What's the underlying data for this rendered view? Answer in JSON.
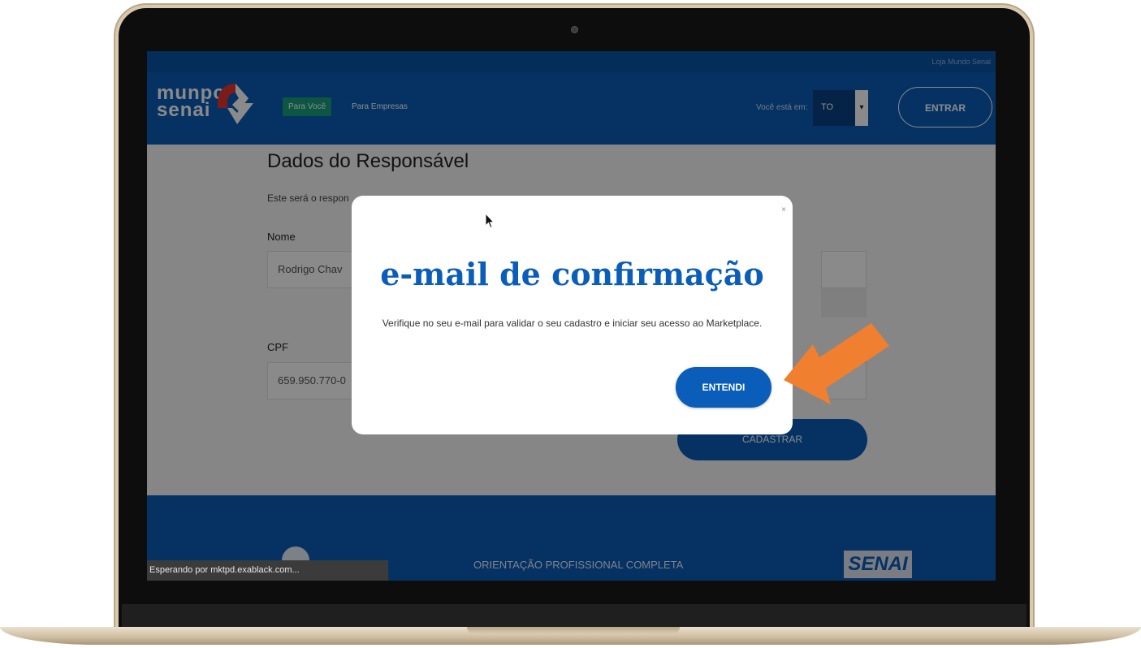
{
  "store_link": "Loja Mundo Senai",
  "logo": {
    "line1": "munpo",
    "line2": "senai"
  },
  "nav": {
    "pessoal": "Para Você",
    "empresas": "Para Empresas"
  },
  "location": {
    "label": "Você está em:",
    "value": "TO"
  },
  "login_label": "ENTRAR",
  "form": {
    "title": "Dados do Responsável",
    "description": "Este será o respon",
    "name_label": "Nome",
    "name_value": "Rodrigo Chav",
    "cpf_label": "CPF",
    "cpf_value": "659.950.770-0",
    "submit_label": "CADASTRAR"
  },
  "modal": {
    "close_label": "×",
    "title": "e-mail de confirmação",
    "message": "Verifique no seu e-mail para validar o seu cadastro e iniciar seu acesso ao Marketplace.",
    "ok_label": "ENTENDI"
  },
  "footer": {
    "slogan": "ORIENTAÇÃO PROFISSIONAL COMPLETA",
    "brand": "SENAI"
  },
  "status_text": "Esperando por mktpd.exablack.com...",
  "colors": {
    "primary": "#0a5db8",
    "accent": "#17a07a",
    "arrow": "#f07f2f"
  },
  "icons": [
    "cursor-icon",
    "arrow-icon",
    "close-icon",
    "logo-mark-icon"
  ]
}
